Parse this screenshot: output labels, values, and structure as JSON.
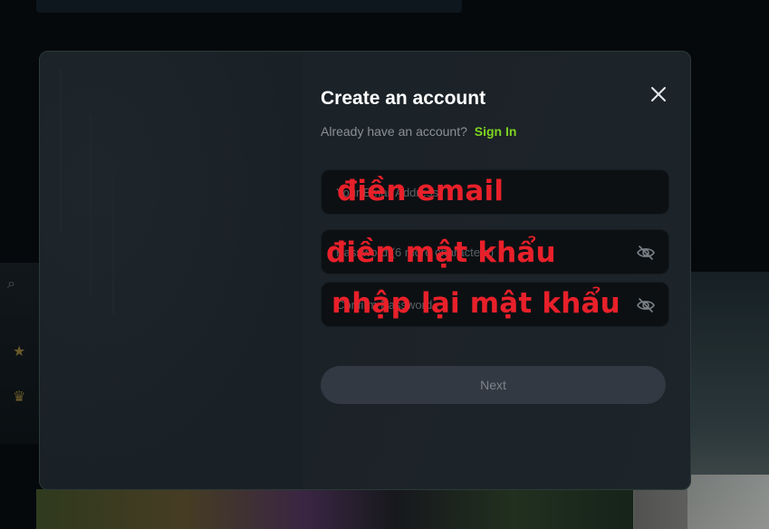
{
  "modal": {
    "title": "Create an account",
    "subtitle": "Already have an account?",
    "signin_label": "Sign In",
    "fields": {
      "email": {
        "placeholder": "Your Email Address",
        "value": ""
      },
      "password": {
        "placeholder": "Password (6 more characters)",
        "value": ""
      },
      "confirm_password": {
        "placeholder": "Confirm Password",
        "value": ""
      }
    },
    "next_label": "Next"
  },
  "annotations": {
    "email": "điền email",
    "password": "điền mật khẩu",
    "confirm_password": "nhập lại mật khẩu"
  },
  "colors": {
    "accent": "#7ed321",
    "annotation": "#e8202a",
    "title": "#ffffff",
    "button_bg": "#333942"
  },
  "icons": {
    "close": "close-icon",
    "eye": "eye-slash-icon"
  }
}
